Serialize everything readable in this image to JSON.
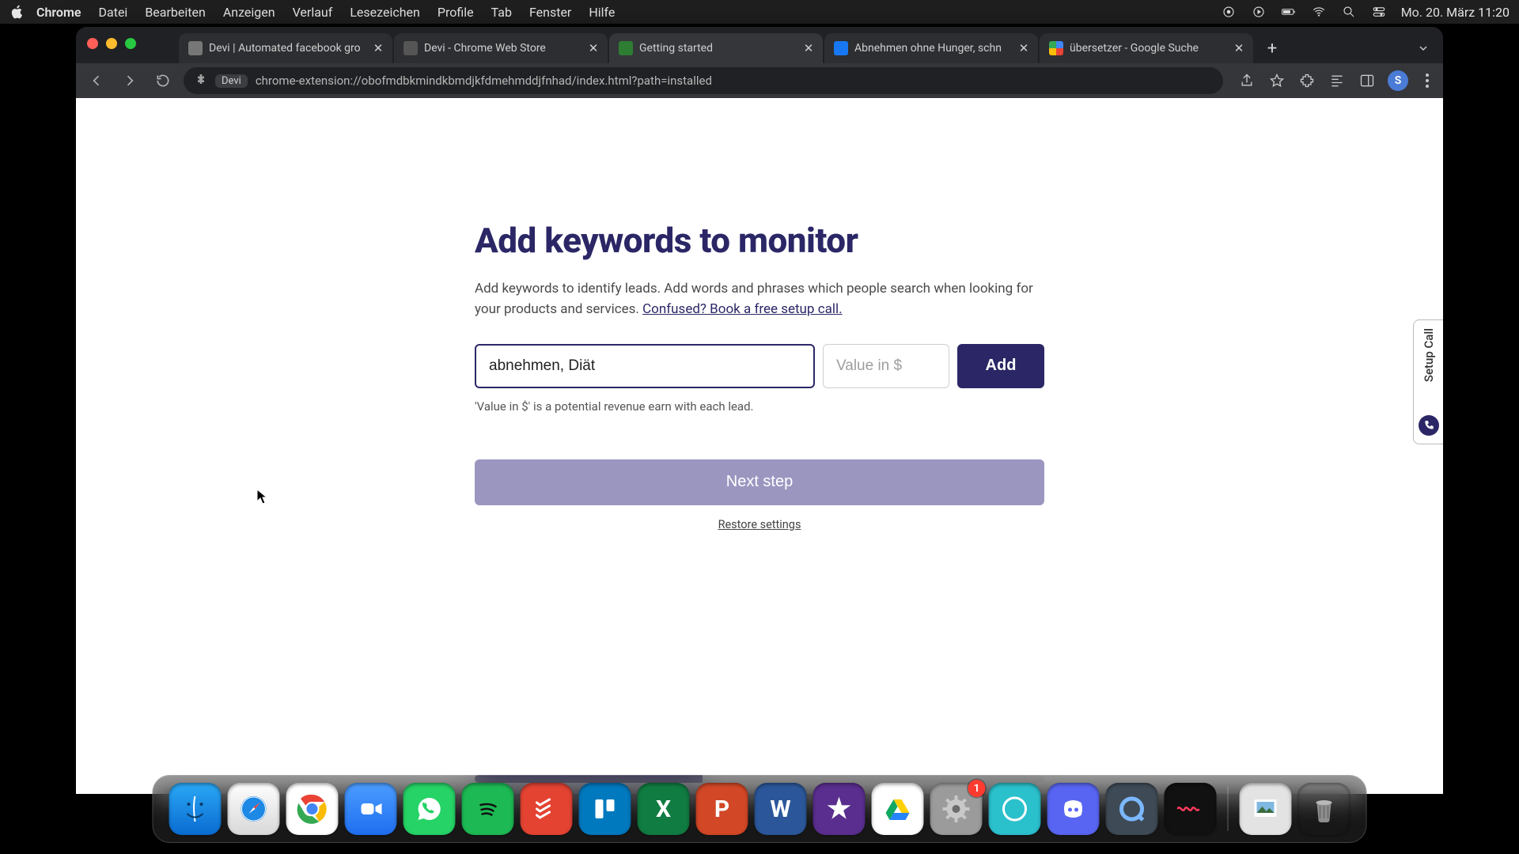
{
  "menubar": {
    "app_name": "Chrome",
    "items": [
      "Datei",
      "Bearbeiten",
      "Anzeigen",
      "Verlauf",
      "Lesezeichen",
      "Profile",
      "Tab",
      "Fenster",
      "Hilfe"
    ],
    "clock": "Mo. 20. März  11:20"
  },
  "tabs": [
    {
      "title": "Devi | Automated facebook gro",
      "favicon": "generic"
    },
    {
      "title": "Devi - Chrome Web Store",
      "favicon": "store"
    },
    {
      "title": "Getting started",
      "favicon": "green",
      "active": true
    },
    {
      "title": "Abnehmen ohne Hunger, schn",
      "favicon": "fb"
    },
    {
      "title": "übersetzer - Google Suche",
      "favicon": "goog"
    }
  ],
  "omnibox": {
    "ext_chip": "Devi",
    "url": "chrome-extension://obofmdbkmindkbmdjkfdmehmddjfnhad/index.html?path=installed"
  },
  "avatar_initial": "S",
  "page": {
    "heading": "Add keywords to monitor",
    "subtitle_pre": "Add keywords to identify leads. Add words and phrases which people search when looking for your products and services. ",
    "subtitle_link": "Confused? Book a free setup call.",
    "keyword_value": "abnehmen, Diät",
    "keyword_placeholder": "",
    "value_value": "",
    "value_placeholder": "Value in $",
    "add_label": "Add",
    "helper": "'Value in $' is a potential revenue earn with each lead.",
    "next_label": "Next step",
    "restore_label": "Restore settings",
    "progress_percent": 40
  },
  "side_tab": {
    "label": "Setup Call"
  },
  "dock": {
    "items": [
      {
        "name": "finder",
        "glyph": "",
        "label": "Finder"
      },
      {
        "name": "safari",
        "glyph": "",
        "label": "Safari"
      },
      {
        "name": "chrome",
        "glyph": "",
        "label": "Google Chrome"
      },
      {
        "name": "zoom",
        "glyph": "",
        "label": "Zoom"
      },
      {
        "name": "whatsapp",
        "glyph": "",
        "label": "WhatsApp"
      },
      {
        "name": "spotify",
        "glyph": "",
        "label": "Spotify"
      },
      {
        "name": "todoist",
        "glyph": "",
        "label": "Todoist"
      },
      {
        "name": "trello",
        "glyph": "",
        "label": "Trello"
      },
      {
        "name": "excel",
        "glyph": "X",
        "label": "Excel"
      },
      {
        "name": "ppt",
        "glyph": "P",
        "label": "PowerPoint"
      },
      {
        "name": "word",
        "glyph": "W",
        "label": "Word"
      },
      {
        "name": "imovie",
        "glyph": "★",
        "label": "iMovie"
      },
      {
        "name": "drive",
        "glyph": "",
        "label": "Google Drive"
      },
      {
        "name": "settings",
        "glyph": "",
        "label": "Systemeinstellungen",
        "badge": "1"
      },
      {
        "name": "teal",
        "glyph": "",
        "label": "App"
      },
      {
        "name": "discord",
        "glyph": "",
        "label": "Discord"
      },
      {
        "name": "quicktime",
        "glyph": "",
        "label": "QuickTime Player"
      },
      {
        "name": "voice",
        "glyph": "",
        "label": "Voice Memos"
      }
    ],
    "right": [
      {
        "name": "preview",
        "glyph": "",
        "label": "Preview"
      },
      {
        "name": "trash",
        "glyph": "",
        "label": "Papierkorb"
      }
    ]
  }
}
